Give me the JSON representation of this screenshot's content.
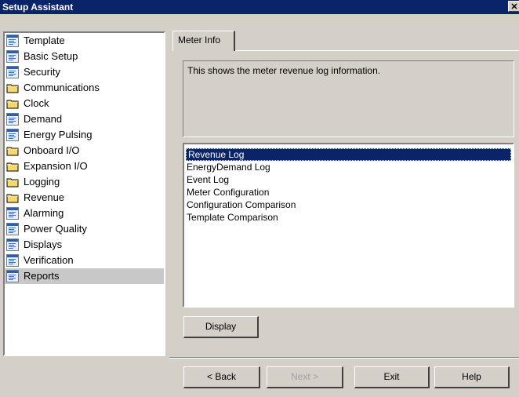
{
  "window": {
    "title": "Setup Assistant",
    "close_glyph": "✕"
  },
  "sidebar": {
    "items": [
      {
        "label": "Template",
        "icon": "document-icon"
      },
      {
        "label": "Basic Setup",
        "icon": "document-icon"
      },
      {
        "label": "Security",
        "icon": "document-icon"
      },
      {
        "label": "Communications",
        "icon": "folder-icon"
      },
      {
        "label": "Clock",
        "icon": "folder-icon"
      },
      {
        "label": "Demand",
        "icon": "document-icon"
      },
      {
        "label": "Energy Pulsing",
        "icon": "document-icon"
      },
      {
        "label": "Onboard I/O",
        "icon": "folder-icon"
      },
      {
        "label": "Expansion I/O",
        "icon": "folder-icon"
      },
      {
        "label": "Logging",
        "icon": "folder-icon"
      },
      {
        "label": "Revenue",
        "icon": "folder-icon"
      },
      {
        "label": "Alarming",
        "icon": "document-icon"
      },
      {
        "label": "Power Quality",
        "icon": "document-icon"
      },
      {
        "label": "Displays",
        "icon": "document-icon"
      },
      {
        "label": "Verification",
        "icon": "document-icon"
      },
      {
        "label": "Reports",
        "icon": "document-icon",
        "selected": true
      }
    ]
  },
  "tab": {
    "label": "Meter Info"
  },
  "description": {
    "text": "This shows the meter revenue log information."
  },
  "list": {
    "items": [
      {
        "label": "Revenue Log",
        "selected": true
      },
      {
        "label": "EnergyDemand Log"
      },
      {
        "label": "Event Log"
      },
      {
        "label": "Meter Configuration"
      },
      {
        "label": "Configuration Comparison"
      },
      {
        "label": "Template Comparison"
      }
    ]
  },
  "buttons": {
    "display": "Display",
    "back": "< Back",
    "next": "Next >",
    "exit": "Exit",
    "help": "Help"
  },
  "colors": {
    "titlebar": "#0a246a",
    "selection": "#0a246a",
    "face": "#d4d0c8"
  }
}
